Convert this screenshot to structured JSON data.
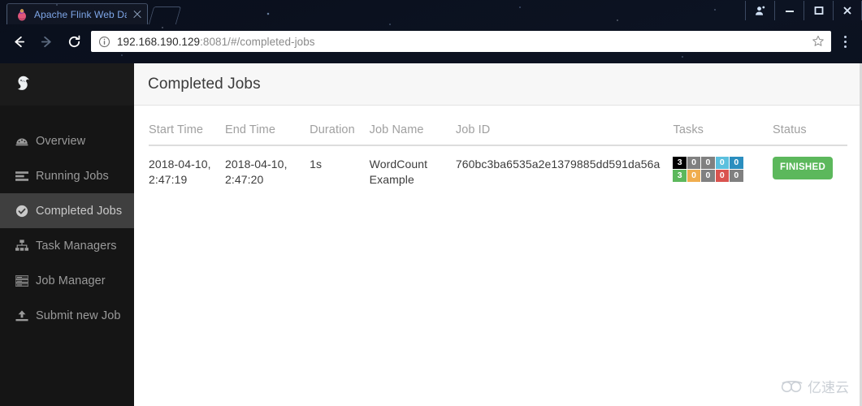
{
  "browser": {
    "tab": {
      "title": "Apache Flink Web Das",
      "favicon_icon": "flink-squirrel-icon",
      "close_icon": "close-icon"
    },
    "new_tab_icon": "new-tab-icon",
    "window_controls": {
      "profile_icon": "user-profile-icon",
      "minimize_icon": "minimize-icon",
      "maximize_icon": "maximize-icon",
      "close_icon": "window-close-icon"
    },
    "toolbar": {
      "back_icon": "back-arrow-icon",
      "forward_icon": "forward-arrow-icon",
      "reload_icon": "reload-icon",
      "info_icon": "page-info-icon",
      "url_host": "192.168.190.129",
      "url_rest": ":8081/#/completed-jobs",
      "url_full": "192.168.190.129:8081/#/completed-jobs",
      "bookmark_icon": "star-icon",
      "menu_icon": "kebab-menu-icon"
    }
  },
  "sidebar": {
    "logo_icon": "flink-squirrel-logo",
    "items": [
      {
        "label": "Overview",
        "icon": "dashboard-icon",
        "active": false
      },
      {
        "label": "Running Jobs",
        "icon": "tasks-list-icon",
        "active": false
      },
      {
        "label": "Completed Jobs",
        "icon": "check-circle-icon",
        "active": true
      },
      {
        "label": "Task Managers",
        "icon": "sitemap-icon",
        "active": false
      },
      {
        "label": "Job Manager",
        "icon": "server-list-icon",
        "active": false
      },
      {
        "label": "Submit new Job",
        "icon": "upload-icon",
        "active": false
      }
    ]
  },
  "page": {
    "title": "Completed Jobs"
  },
  "table": {
    "columns": [
      "Start Time",
      "End Time",
      "Duration",
      "Job Name",
      "Job ID",
      "Tasks",
      "Status"
    ],
    "rows": [
      {
        "start_time": "2018-04-10, 2:47:19",
        "end_time": "2018-04-10, 2:47:20",
        "duration": "1s",
        "job_name": "WordCount Example",
        "job_id": "760bc3ba6535a2e1379885dd591da56a",
        "tasks": {
          "top": [
            "3",
            "0",
            "0",
            "0",
            "0"
          ],
          "bottom": [
            "3",
            "0",
            "0",
            "0",
            "0"
          ]
        },
        "status": "FINISHED"
      }
    ]
  },
  "colors": {
    "task_top": [
      "#000000",
      "#808080",
      "#808080",
      "#5bc0de",
      "#2b8ebf"
    ],
    "task_bottom": [
      "#5cb85c",
      "#f0ad4e",
      "#808080",
      "#d9534f",
      "#808080"
    ],
    "status_finished_bg": "#5cb85c",
    "sidebar_bg": "#151515",
    "sidebar_active_bg": "#3f3f3f",
    "page_header_bg": "#f7f7f7"
  },
  "watermark": {
    "text": "亿速云",
    "icon": "cloud-logo-icon"
  }
}
